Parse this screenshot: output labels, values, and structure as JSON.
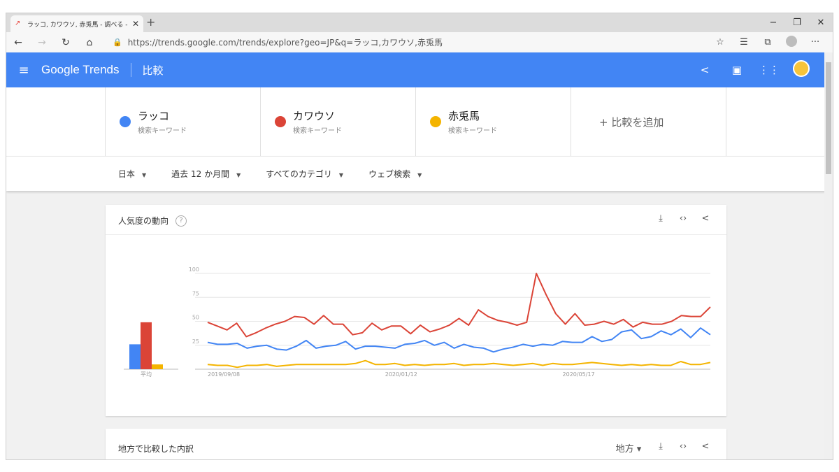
{
  "browser": {
    "tab_title": "ラッコ, カワウソ, 赤兎馬 - 調べる - G",
    "tab_close": "✕",
    "new_tab": "+",
    "window_controls": [
      "−",
      "❐",
      "✕"
    ],
    "url": "https://trends.google.com/trends/explore?geo=JP&q=ラッコ,カワウソ,赤兎馬"
  },
  "header": {
    "logo": "Google Trends",
    "page": "比較"
  },
  "keywords": [
    {
      "name": "ラッコ",
      "sub": "検索キーワード",
      "color": "#4285f4"
    },
    {
      "name": "カワウソ",
      "sub": "検索キーワード",
      "color": "#db4437"
    },
    {
      "name": "赤兎馬",
      "sub": "検索キーワード",
      "color": "#f4b400"
    }
  ],
  "add_compare": "+ 比較を追加",
  "filters": [
    "日本",
    "過去 12 か月間",
    "すべてのカテゴリ",
    "ウェブ検索"
  ],
  "card1": {
    "title": "人気度の動向",
    "help": "?"
  },
  "card2": {
    "title": "地方で比較した内訳",
    "dropdown": "地方"
  },
  "chart_data": {
    "type": "line",
    "title": "人気度の動向",
    "ylim": [
      0,
      100
    ],
    "yticks": [
      25,
      50,
      75,
      100
    ],
    "xtick_labels": [
      "2019/09/08",
      "2020/01/12",
      "2020/05/17"
    ],
    "xtick_index": [
      0,
      18,
      36
    ],
    "avg_label": "平均",
    "averages": [
      26,
      49,
      5
    ],
    "series": [
      {
        "name": "ラッコ",
        "color": "#4285f4",
        "values": [
          28,
          26,
          26,
          27,
          22,
          24,
          25,
          21,
          20,
          24,
          30,
          22,
          24,
          25,
          29,
          21,
          24,
          24,
          23,
          22,
          26,
          27,
          30,
          25,
          28,
          22,
          26,
          23,
          22,
          18,
          21,
          23,
          26,
          24,
          26,
          25,
          29,
          28,
          28,
          34,
          29,
          31,
          39,
          41,
          32,
          34,
          40,
          36,
          42,
          33,
          43,
          36
        ]
      },
      {
        "name": "カワウソ",
        "color": "#db4437",
        "values": [
          49,
          45,
          41,
          48,
          34,
          38,
          43,
          47,
          50,
          55,
          54,
          47,
          56,
          47,
          47,
          36,
          38,
          48,
          41,
          45,
          45,
          37,
          46,
          39,
          42,
          46,
          53,
          46,
          62,
          55,
          51,
          49,
          46,
          49,
          100,
          78,
          58,
          47,
          58,
          46,
          47,
          50,
          47,
          52,
          44,
          49,
          47,
          47,
          50,
          56,
          55,
          55,
          65
        ]
      },
      {
        "name": "赤兎馬",
        "color": "#f4b400",
        "values": [
          5,
          4,
          4,
          2,
          4,
          4,
          5,
          3,
          4,
          5,
          5,
          5,
          5,
          5,
          5,
          6,
          9,
          5,
          5,
          6,
          4,
          5,
          4,
          5,
          5,
          6,
          4,
          5,
          5,
          6,
          5,
          4,
          5,
          6,
          4,
          6,
          5,
          5,
          6,
          7,
          6,
          5,
          4,
          5,
          4,
          5,
          4,
          4,
          8,
          5,
          5,
          7
        ]
      }
    ]
  }
}
